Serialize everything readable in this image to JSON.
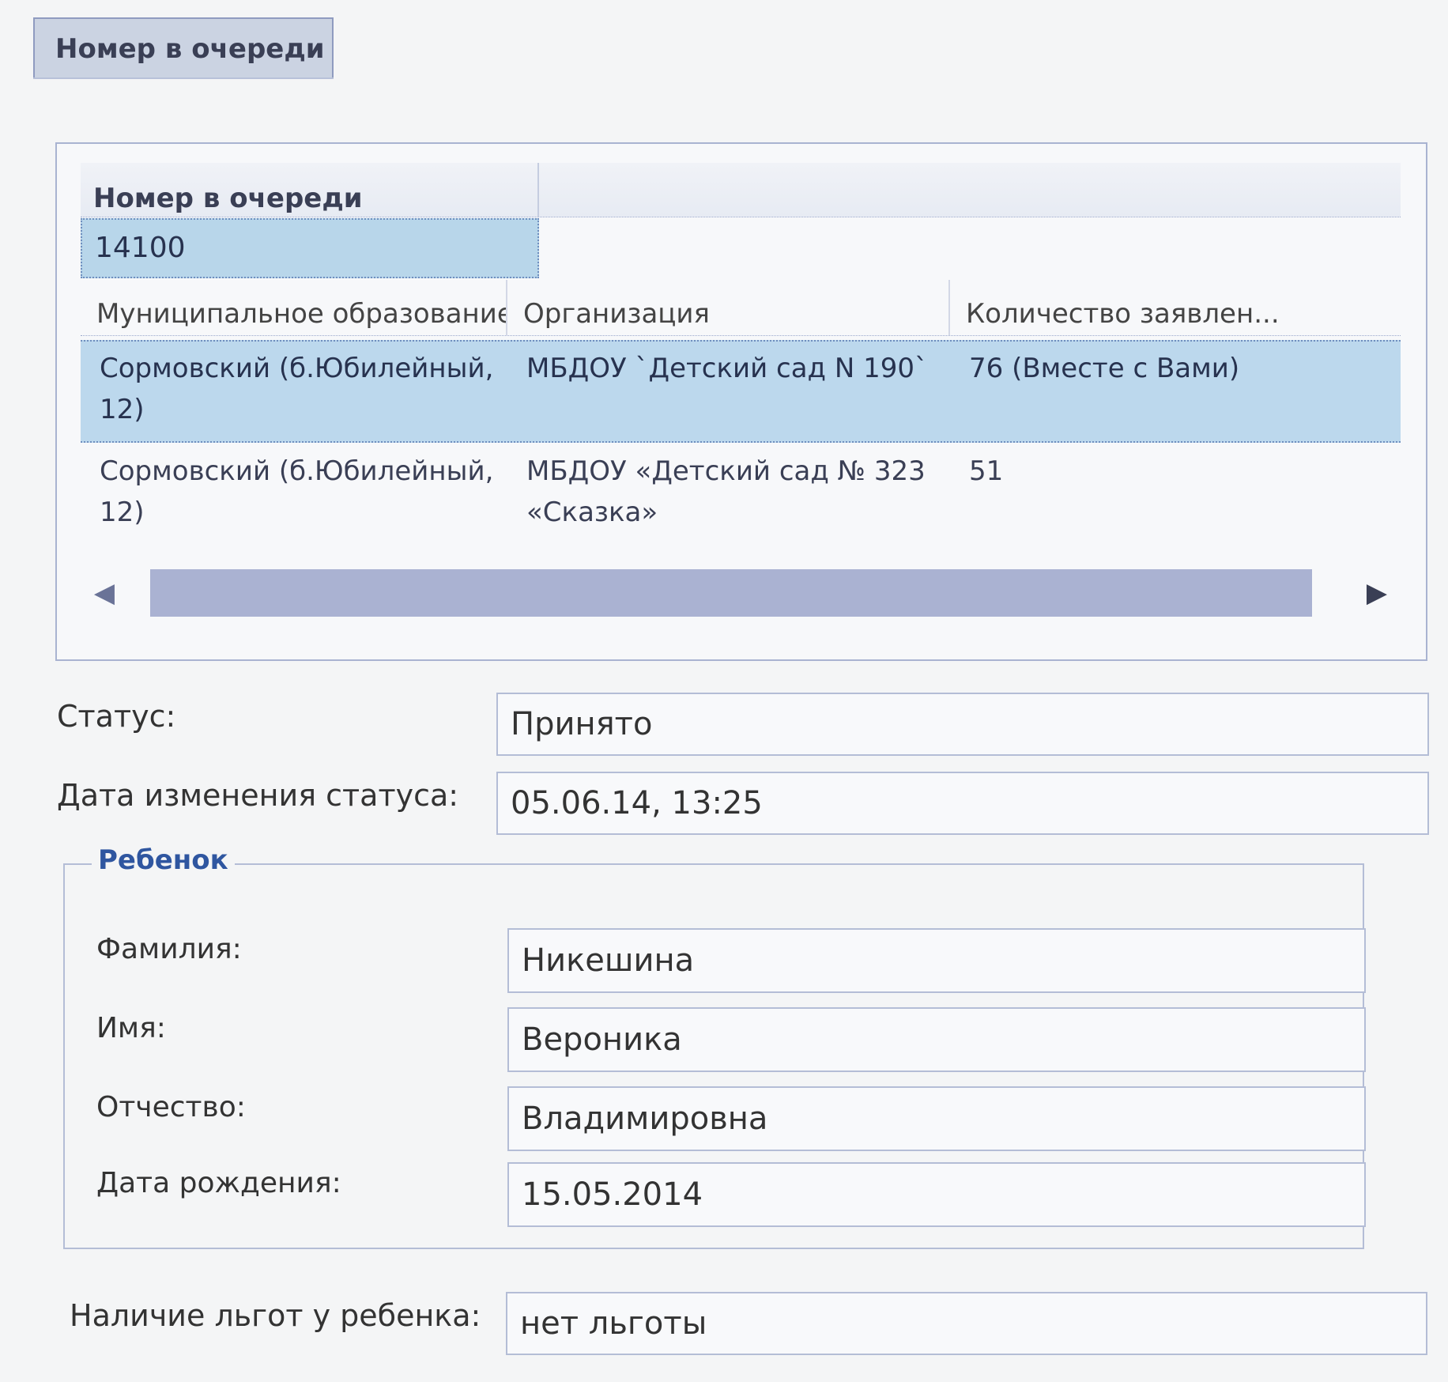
{
  "tab": {
    "label": "Номер в очереди"
  },
  "queue": {
    "header": "Номер в очереди",
    "value": "14100"
  },
  "table": {
    "columns": [
      "Муниципальное образование",
      "Организация",
      "Количество заявлен..."
    ],
    "rows": [
      {
        "municipality": "Сормовский (б.Юбилейный, 12)",
        "organization": "МБДОУ `Детский сад N 190`",
        "count": "76 (Вместе с Вами)"
      },
      {
        "municipality": "Сормовский (б.Юбилейный, 12)",
        "organization": "МБДОУ «Детский сад № 323 «Сказка»",
        "count": "51"
      }
    ]
  },
  "status": {
    "label": "Статус:",
    "value": "Принято"
  },
  "status_date": {
    "label": "Дата изменения статуса:",
    "value": "05.06.14, 13:25"
  },
  "child": {
    "legend": "Ребенок",
    "surname_label": "Фамилия:",
    "surname": "Никешина",
    "name_label": "Имя:",
    "name": "Вероника",
    "patronymic_label": "Отчество:",
    "patronymic": "Владимировна",
    "birth_label": "Дата рождения:",
    "birth": "15.05.2014"
  },
  "benefits": {
    "label": "Наличие льгот у ребенка:",
    "value": "нет льготы"
  },
  "colors": {
    "selection": "#bcd8ed",
    "accent": "#2f56a0",
    "scrollbar": "#aab2d2"
  },
  "icons": {
    "scroll_left": "arrow-left-icon",
    "scroll_right": "arrow-right-icon"
  }
}
